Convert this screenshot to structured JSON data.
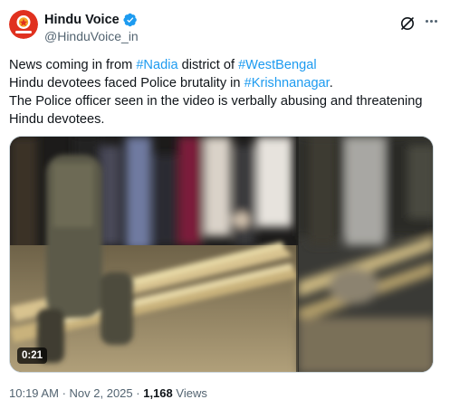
{
  "author": {
    "display_name": "Hindu Voice",
    "handle": "@HinduVoice_in",
    "verified": true
  },
  "tweet": {
    "lines": [
      [
        {
          "t": "News coming in from "
        },
        {
          "t": "#Nadia",
          "tag": true
        },
        {
          "t": " district of "
        },
        {
          "t": "#WestBengal",
          "tag": true
        }
      ],
      [
        {
          "t": "Hindu devotees faced Police brutality in "
        },
        {
          "t": "#Krishnanagar",
          "tag": true
        },
        {
          "t": "."
        }
      ],
      [
        {
          "t": "The Police officer seen in the video is verbally abusing and threatening"
        }
      ],
      [
        {
          "t": "Hindu devotees."
        }
      ]
    ]
  },
  "media": {
    "duration": "0:21"
  },
  "meta": {
    "time": "10:19 AM",
    "separator": "·",
    "date": "Nov 2, 2025",
    "views_count": "1,168",
    "views_label": "Views"
  },
  "colors": {
    "accent": "#1d9bf0",
    "text": "#0f1419",
    "muted": "#536471",
    "avatar_red": "#e0311f"
  },
  "icons": {
    "verified": "verified-badge-icon",
    "grok": "grok-icon",
    "more": "more-options-icon"
  }
}
